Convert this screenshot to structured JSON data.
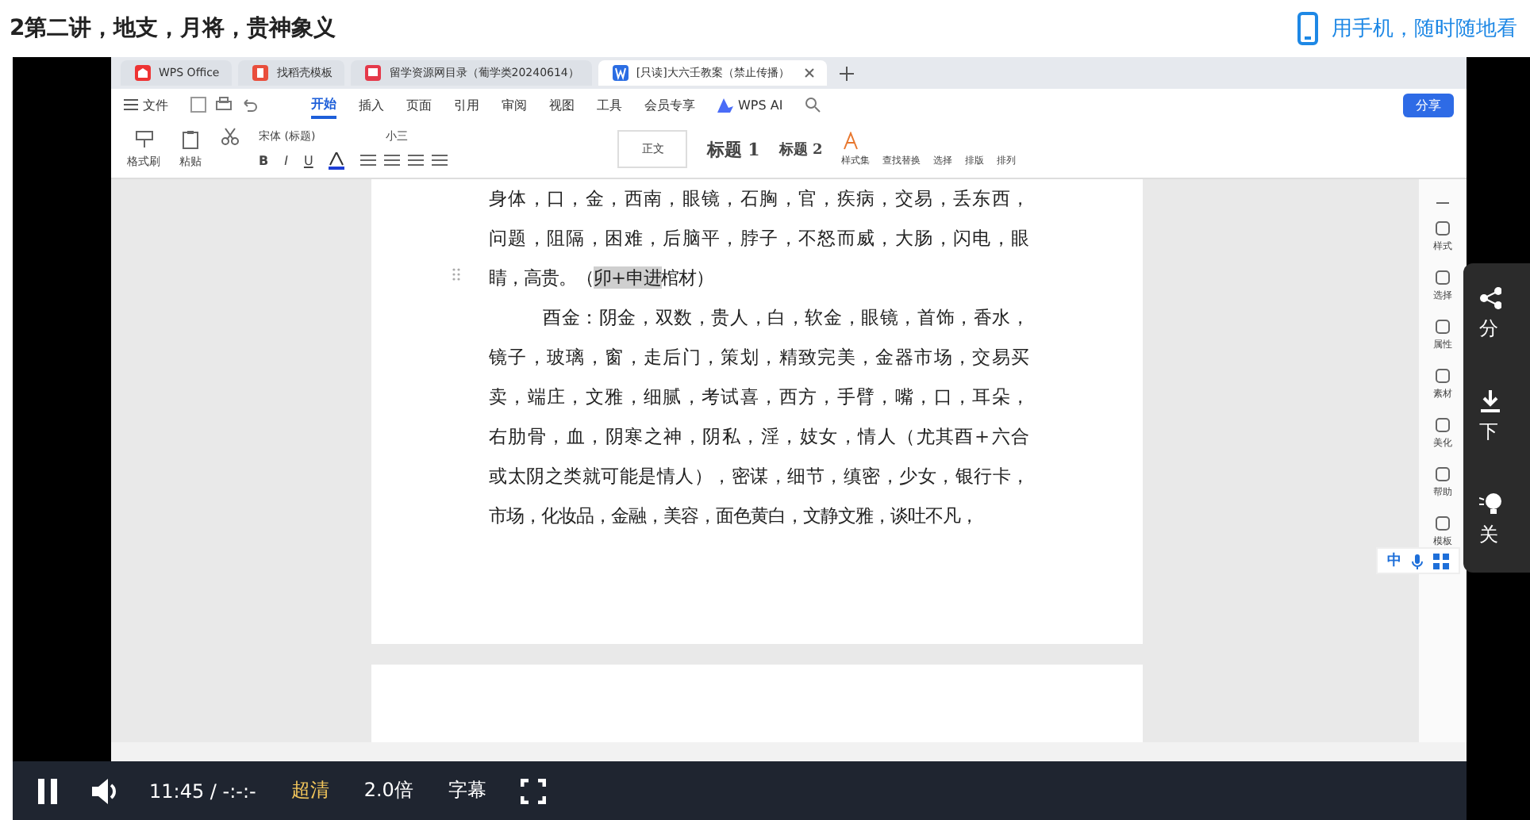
{
  "video_title": "2第二讲，地支，月将，贵神象义",
  "mobile_link": "用手机，随时随地看",
  "app_tabs": [
    {
      "label": "WPS Office",
      "kind": "home",
      "selected": false
    },
    {
      "label": "找稻壳模板",
      "kind": "template",
      "selected": false
    },
    {
      "label": "留学资源网目录（葡学类20240614）",
      "kind": "pdf",
      "selected": false
    },
    {
      "label": "[只读]大六壬教案（禁止传播）",
      "kind": "doc",
      "selected": true
    }
  ],
  "menu": {
    "file": "文件",
    "items": [
      {
        "label": "开始",
        "selected": true
      },
      {
        "label": "插入",
        "selected": false
      },
      {
        "label": "页面",
        "selected": false
      },
      {
        "label": "引用",
        "selected": false
      },
      {
        "label": "审阅",
        "selected": false
      },
      {
        "label": "视图",
        "selected": false
      },
      {
        "label": "工具",
        "selected": false
      },
      {
        "label": "会员专享",
        "selected": false
      }
    ],
    "ai": "WPS AI",
    "share": "分享"
  },
  "ribbon": {
    "format_painter": "格式刷",
    "paste": "粘贴",
    "font": "宋体 (标题)",
    "size": "小三",
    "format_buttons": [
      "B",
      "I",
      "U"
    ],
    "styles": [
      {
        "label": "正文",
        "kind": "body"
      },
      {
        "label": "标题 1",
        "kind": "h1"
      },
      {
        "label": "标题 2",
        "kind": "h2"
      }
    ],
    "tools": [
      "样式集",
      "查找替换",
      "选择",
      "排版",
      "排列"
    ]
  },
  "document": {
    "paragraphs": [
      {
        "indent": false,
        "lines": [
          {
            "text": "身体，口，金，西南，眼镜，石胸，官，疾病，交易，丢东西，"
          },
          {
            "text": "问题，阻隔，困难，后脑平，脖子，不怒而威，大肠，闪电，眼"
          },
          {
            "parts": [
              {
                "text": "睛，高贵。（",
                "highlighted": false
              },
              {
                "text": "卯+申进",
                "highlighted": true
              },
              {
                "text": "棺材）",
                "highlighted": false
              }
            ]
          }
        ]
      },
      {
        "indent": true,
        "lines": [
          {
            "text": "酉金：阴金，双数，贵人，白，软金，眼镜，首饰，香水，"
          },
          {
            "text": "镜子，玻璃，窗，走后门，策划，精致完美，金器市场，交易买"
          },
          {
            "text": "卖，端庄，文雅，细腻，考试喜，西方，手臂，嘴，口，耳朵，"
          },
          {
            "text": "右肋骨，血，阴寒之神，阴私，淫，妓女，情人（尤其酉+六合"
          },
          {
            "text": "或太阴之类就可能是情人），密谋，细节，缜密，少女，银行卡，"
          },
          {
            "text": "市场，化妆品，金融，美容，面色黄白，文静文雅，谈吐不凡，"
          }
        ]
      }
    ]
  },
  "sidebar_tools": [
    "样式",
    "选择",
    "属性",
    "素材",
    "美化",
    "帮助",
    "模板"
  ],
  "ime": "中",
  "player": {
    "playing": true,
    "time": "11:45 / -:-:-",
    "quality": "超清",
    "speed": "2.0倍",
    "subtitles": "字幕"
  },
  "share_panel": [
    "分",
    "下",
    "关"
  ]
}
